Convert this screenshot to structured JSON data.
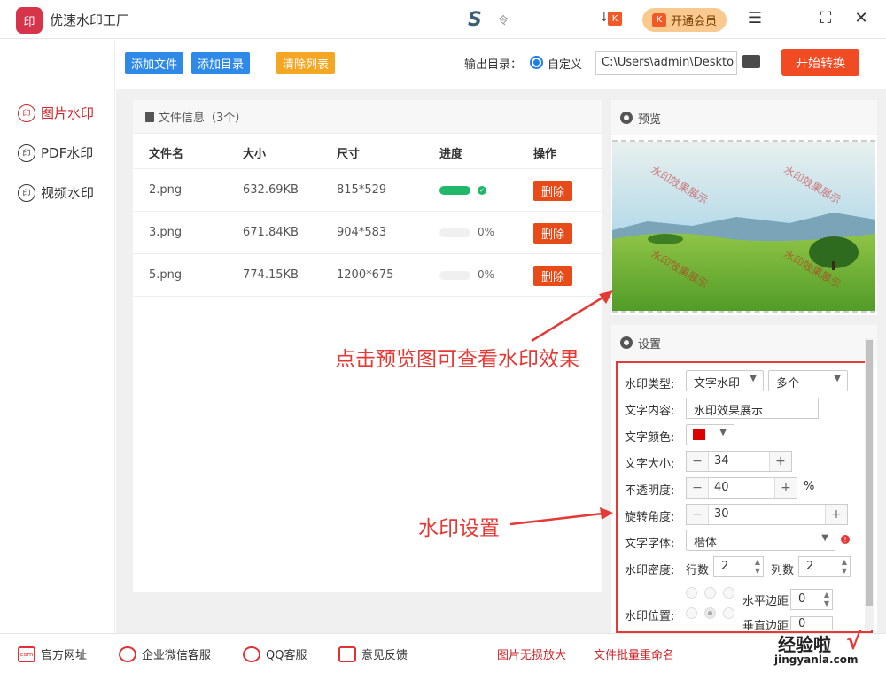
{
  "app": {
    "logo_text": "印",
    "title": "优速水印工厂",
    "mid_brand": "S",
    "mid_brand_small": "令",
    "bd_icon": "↓",
    "vip_label": "开通会员",
    "vip_icon": "K"
  },
  "window": {
    "menu_icon": "menu-icon",
    "max_icon": "maximize-icon",
    "close_icon": "close-icon"
  },
  "sidebar": {
    "items": [
      {
        "label": "图片水印",
        "icon": "印",
        "active": true
      },
      {
        "label": "PDF水印",
        "icon": "印",
        "active": false
      },
      {
        "label": "视频水印",
        "icon": "印",
        "active": false
      }
    ]
  },
  "toolbar": {
    "add_file": "添加文件",
    "add_dir": "添加目录",
    "clear_list": "清除列表",
    "output_label": "输出目录：",
    "custom_label": "自定义",
    "path_value": "C:\\Users\\admin\\Deskto",
    "start_label": "开始转换"
  },
  "files": {
    "header": "文件信息（3个）",
    "columns": [
      "文件名",
      "大小",
      "尺寸",
      "进度",
      "操作"
    ],
    "rows": [
      {
        "name": "2.png",
        "size": "632.69KB",
        "dim": "815*529",
        "progress": 1.0,
        "progress_text": "",
        "action": "删除"
      },
      {
        "name": "3.png",
        "size": "671.84KB",
        "dim": "904*583",
        "progress": 0.0,
        "progress_text": "0%",
        "action": "删除"
      },
      {
        "name": "5.png",
        "size": "774.15KB",
        "dim": "1200*675",
        "progress": 0.0,
        "progress_text": "0%",
        "action": "删除"
      }
    ]
  },
  "preview": {
    "title": "预览",
    "watermark_text": "水印效果展示"
  },
  "settings": {
    "title": "设置",
    "wm_type_label": "水印类型:",
    "wm_type": "文字水印",
    "wm_count": "多个",
    "text_label": "文字内容:",
    "text_value": "水印效果展示",
    "color_label": "文字颜色:",
    "color_value": "#dd0000",
    "size_label": "文字大小:",
    "size_value": "34",
    "opacity_label": "不透明度:",
    "opacity_value": "40",
    "opacity_unit": "%",
    "rotate_label": "旋转角度:",
    "rotate_value": "30",
    "font_label": "文字字体:",
    "font_value": "楷体",
    "density_label": "水印密度:",
    "rows_label": "行数",
    "rows_value": "2",
    "cols_label": "列数",
    "cols_value": "2",
    "position_label": "水印位置:",
    "hmargin_label": "水平边距",
    "hmargin_value": "0",
    "vmargin_label": "垂直边距",
    "vmargin_value": "0",
    "minus": "−",
    "plus": "+"
  },
  "annotations": {
    "preview_hint": "点击预览图可查看水印效果",
    "settings_hint": "水印设置"
  },
  "footer": {
    "website": "官方网址",
    "website_icon": "com",
    "wechat": "企业微信客服",
    "qq": "QQ客服",
    "feedback": "意见反馈",
    "link1": "图片无损放大",
    "link2": "文件批量重命名"
  },
  "watermark_site": {
    "name": "经验啦",
    "url": "jingyanla.com",
    "check": "√"
  }
}
